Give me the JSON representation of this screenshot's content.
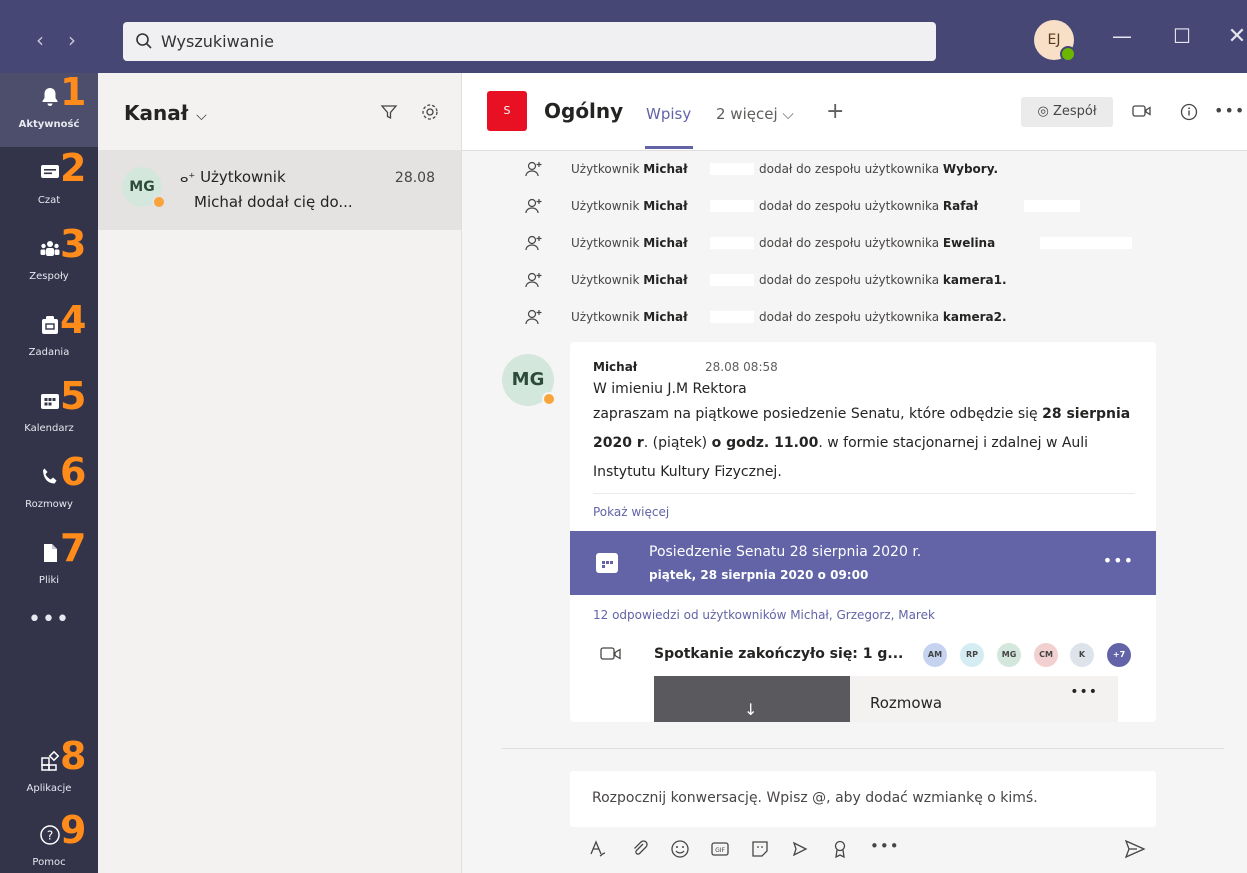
{
  "titlebar": {
    "search_placeholder": "Wyszukiwanie",
    "user_initials": "EJ"
  },
  "rail": {
    "items": [
      {
        "label": "Aktywność",
        "num": "1"
      },
      {
        "label": "Czat",
        "num": "2"
      },
      {
        "label": "Zespoły",
        "num": "3"
      },
      {
        "label": "Zadania",
        "num": "4"
      },
      {
        "label": "Kalendarz",
        "num": "5"
      },
      {
        "label": "Rozmowy",
        "num": "6"
      },
      {
        "label": "Pliki",
        "num": "7"
      },
      {
        "label": "Aplikacje",
        "num": "8"
      },
      {
        "label": "Pomoc",
        "num": "9"
      }
    ],
    "more": "•••"
  },
  "panel": {
    "title": "Kanał",
    "feed": {
      "initials": "MG",
      "title": "Użytkownik",
      "date": "28.08",
      "text": "Michał dodał cię do..."
    }
  },
  "channel": {
    "team_initial": "S",
    "title": "Ogólny",
    "tab_posts": "Wpisy",
    "tab_more": "2 więcej ⌵",
    "team_button": "Zespół"
  },
  "system_messages": [
    {
      "prefix": "Użytkownik",
      "actor": "Michał",
      "action": "dodał do zespołu użytkownika",
      "target": "Wybory."
    },
    {
      "prefix": "Użytkownik",
      "actor": "Michał",
      "action": "dodał do zespołu użytkownika",
      "target": "Rafał"
    },
    {
      "prefix": "Użytkownik",
      "actor": "Michał",
      "action": "dodał do zespołu użytkownika",
      "target": "Ewelina"
    },
    {
      "prefix": "Użytkownik",
      "actor": "Michał",
      "action": "dodał do zespołu użytkownika",
      "target": "kamera1."
    },
    {
      "prefix": "Użytkownik",
      "actor": "Michał",
      "action": "dodał do zespołu użytkownika",
      "target": "kamera2."
    }
  ],
  "post": {
    "initials": "MG",
    "author": "Michał",
    "time": "28.08 08:58",
    "line1": "W imieniu J.M Rektora",
    "body_a": "zapraszam na piątkowe posiedzenie Senatu, które odbędzie się ",
    "body_b": "28 sierpnia 2020 r",
    "body_c": ". (piątek) ",
    "body_d": "o godz. 11.00",
    "body_e": ". w formie stacjonarnej i zdalnej w Auli Instytutu Kultury Fizycznej.",
    "show_more": "Pokaż więcej",
    "event_title": "Posiedzenie Senatu 28 sierpnia 2020 r.",
    "event_sub": "piątek, 28 sierpnia 2020 o 09:00",
    "event_more": "•••",
    "replies": "12 odpowiedzi od użytkowników Michał, Grzegorz, Marek",
    "meeting_text": "Spotkanie zakończyło się: 1 g...",
    "participants": [
      {
        "initials": "AM",
        "color": "#c5d3f0"
      },
      {
        "initials": "RP",
        "color": "#d6ecf3"
      },
      {
        "initials": "MG",
        "color": "#d4e7dc"
      },
      {
        "initials": "CM",
        "color": "#f2d0d0"
      },
      {
        "initials": "K",
        "color": "#dde3ea"
      },
      {
        "initials": "+7",
        "color": "#6264a7"
      }
    ],
    "recording_title": "Rozmowa",
    "recording_more": "•••"
  },
  "compose": {
    "placeholder": "Rozpocznij konwersację. Wpisz @, aby dodać wzmiankę o kimś."
  },
  "colors": {
    "titlebar": "#464775",
    "rail": "#33344a",
    "accent": "#6264a7",
    "number_overlay": "#ff8c1a"
  }
}
